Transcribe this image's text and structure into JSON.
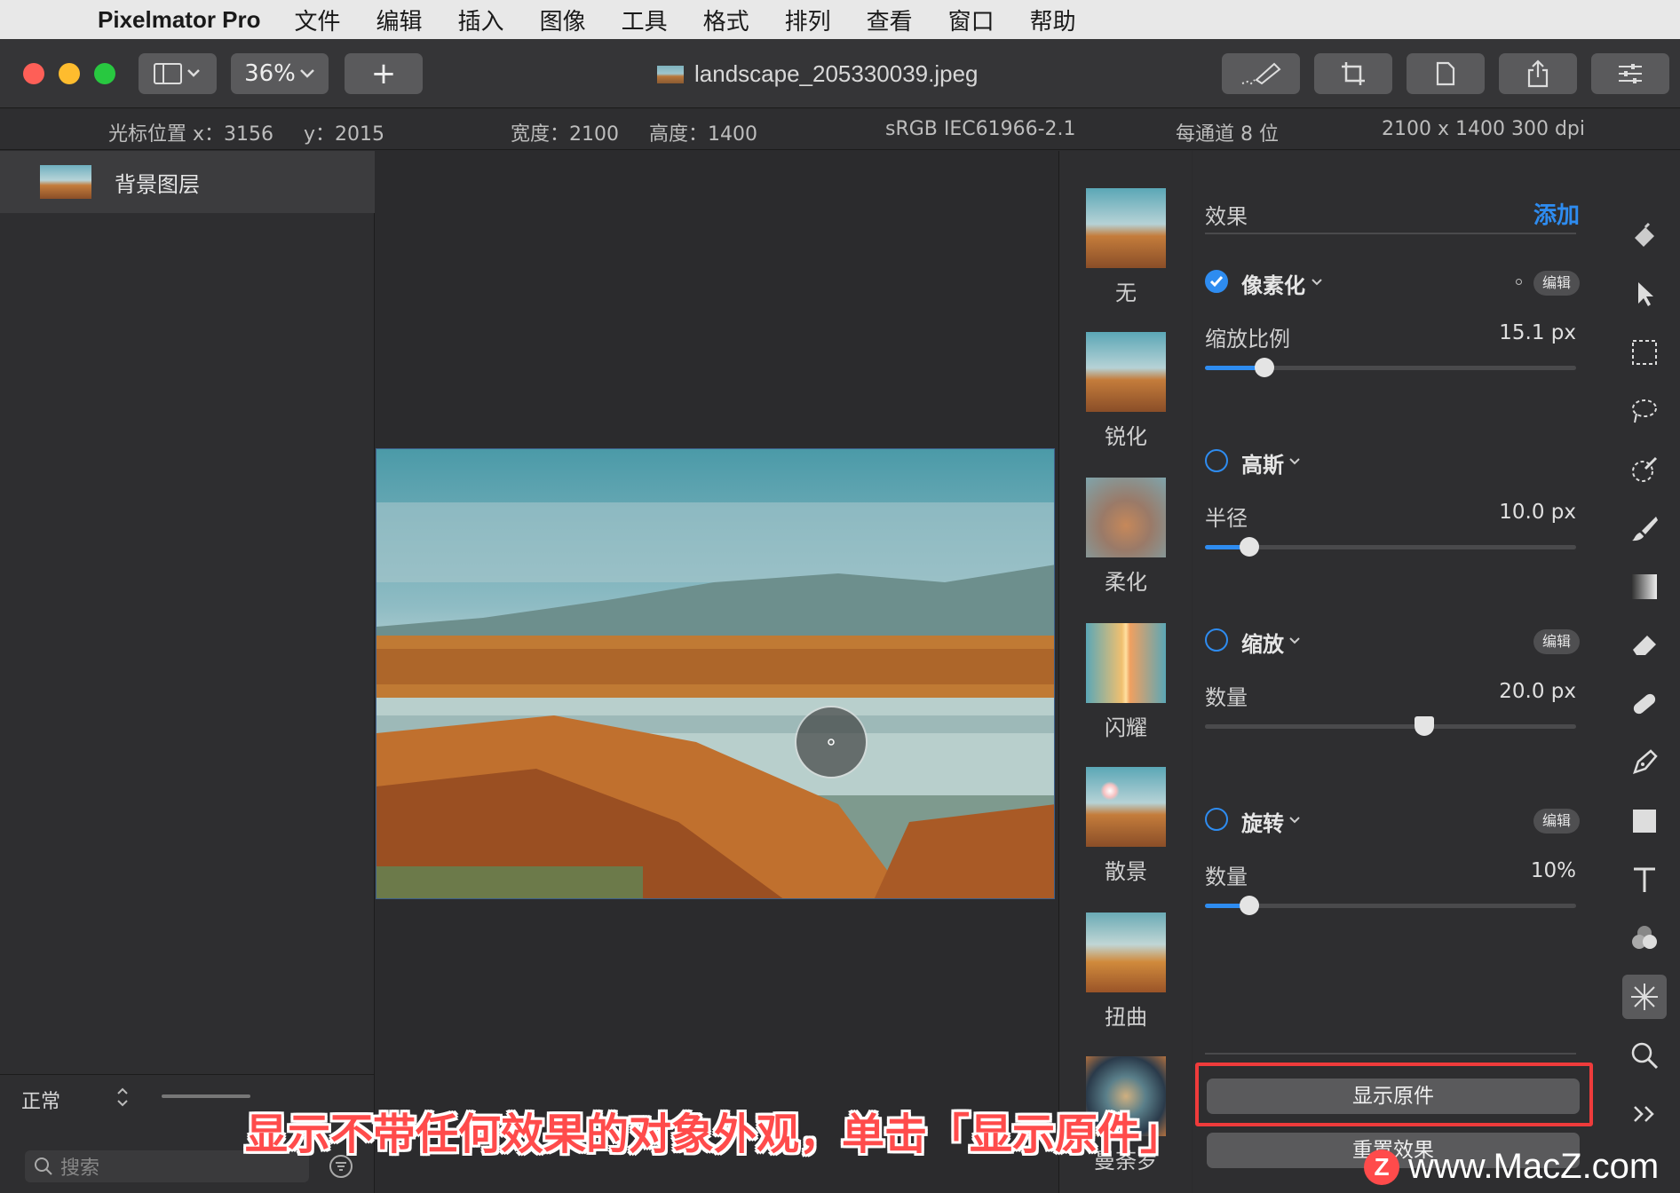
{
  "menubar": {
    "app_name": "Pixelmator Pro",
    "items": [
      "文件",
      "编辑",
      "插入",
      "图像",
      "工具",
      "格式",
      "排列",
      "查看",
      "窗口",
      "帮助"
    ]
  },
  "toolbar": {
    "zoom": "36%",
    "document_title": "landscape_205330039.jpeg"
  },
  "infobar": {
    "cursor_x": "光标位置 x：3156",
    "cursor_y": "y：2015",
    "width": "宽度：2100",
    "height": "高度：1400",
    "color_profile": "sRGB IEC61966-2.1",
    "bit_depth": "每通道 8 位",
    "dimensions": "2100 x 1400 300 dpi"
  },
  "layers": {
    "layer_name": "背景图层",
    "blend_mode": "正常",
    "search_placeholder": "搜索"
  },
  "effects_browser": [
    {
      "label": "无"
    },
    {
      "label": "锐化"
    },
    {
      "label": "柔化"
    },
    {
      "label": "闪耀"
    },
    {
      "label": "散景"
    },
    {
      "label": "扭曲"
    },
    {
      "label": "曼荼罗"
    }
  ],
  "effects_panel": {
    "header": "效果",
    "add_label": "添加",
    "edit_badge": "编辑",
    "effects": [
      {
        "name": "像素化",
        "enabled": true,
        "param_label": "缩放比例",
        "param_value": "15.1 px",
        "level": 0.16
      },
      {
        "name": "高斯",
        "enabled": false,
        "param_label": "半径",
        "param_value": "10.0 px",
        "level": 0.12
      },
      {
        "name": "缩放",
        "enabled": false,
        "param_label": "数量",
        "param_value": "20.0 px",
        "level": 0.59
      },
      {
        "name": "旋转",
        "enabled": false,
        "param_label": "数量",
        "param_value": "10%",
        "level": 0.12
      }
    ],
    "show_original": "显示原件",
    "reset_effects": "重置效果"
  },
  "caption": "显示不带任何效果的对象外观，单击「显示原件」",
  "watermark": "www.MacZ.com",
  "colors": {
    "accent": "#2e8cf0",
    "highlight_border": "#ef3b3b",
    "caption_text": "#ff4b4b"
  }
}
